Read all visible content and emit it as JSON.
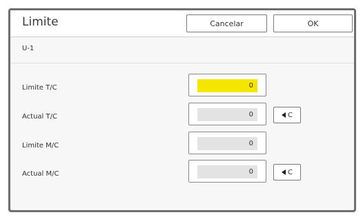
{
  "dialog": {
    "title": "Limite",
    "cancel_label": "Cancelar",
    "ok_label": "OK",
    "subtitle": "U-1"
  },
  "rows": [
    {
      "label": "Limite T/C",
      "value": "0",
      "reset_label": ""
    },
    {
      "label": "Actual T/C",
      "value": "0",
      "reset_label": "C"
    },
    {
      "label": "Limite M/C",
      "value": "0",
      "reset_label": ""
    },
    {
      "label": "Actual M/C",
      "value": "0",
      "reset_label": "C"
    }
  ],
  "colors": {
    "active_field": "#f5e600",
    "frame": "#6e6e6e"
  },
  "icons": {
    "reset": "triangle-left-icon"
  }
}
